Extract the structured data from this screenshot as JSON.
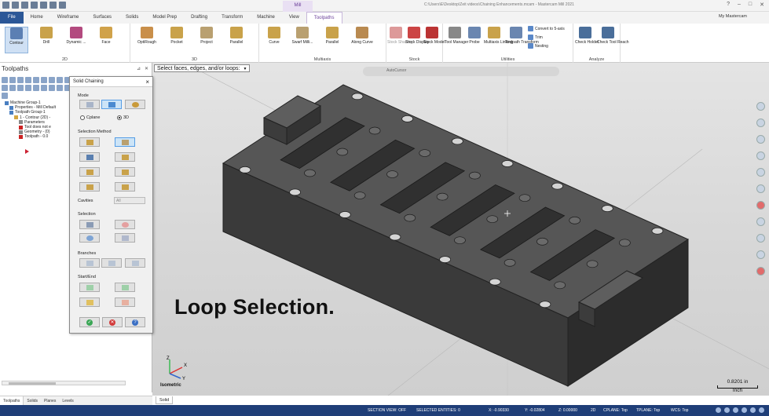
{
  "window": {
    "title": "C:\\Users\\E\\Desktop\\Zeit videos\\Chaining Enhancements.mcam - Mastercam Mill 2021",
    "context_tab": "Mill"
  },
  "tabs": [
    "File",
    "Home",
    "Wireframe",
    "Surfaces",
    "Solids",
    "Model Prep",
    "Drafting",
    "Transform",
    "Machine",
    "View",
    "Toolpaths"
  ],
  "active_tab": "Toolpaths",
  "my_mastercam": "My Mastercam",
  "ribbon": {
    "group_2d": {
      "label": "2D",
      "buttons": [
        "Contour",
        "Drill",
        "Dynamic ...",
        "Face"
      ]
    },
    "group_3d": {
      "label": "3D",
      "buttons": [
        "OptiRough",
        "Pocket",
        "Project",
        "Parallel"
      ]
    },
    "group_multiaxis": {
      "label": "Multiaxis",
      "buttons": [
        "Curve",
        "Swarf Milli...",
        "Parallel",
        "Along Curve"
      ]
    },
    "group_stock": {
      "label": "Stock",
      "buttons": [
        "Stock Shading",
        "Stock Display",
        "Stock Model"
      ]
    },
    "group_utilities": {
      "label": "Utilities",
      "buttons": [
        "Tool Manager",
        "Probe",
        "Multiaxis Linking",
        "Toolpath Transform"
      ],
      "small": [
        "Convert to 5-axis",
        "Trim",
        "Nesting"
      ]
    },
    "group_analyze": {
      "label": "Analyze",
      "buttons": [
        "Check Holder",
        "Check Tool Reach"
      ]
    }
  },
  "left_panel": {
    "title": "Toolpaths",
    "tree": [
      {
        "label": "Machine Group-1",
        "indent": 0,
        "color": "#4a7fc1"
      },
      {
        "label": "Properties - Mill Default",
        "indent": 1,
        "color": "#4a7fc1"
      },
      {
        "label": "Toolpath Group-1",
        "indent": 1,
        "color": "#4a7fc1"
      },
      {
        "label": "1 - Contour (2D) -",
        "indent": 2,
        "color": "#d4a640"
      },
      {
        "label": "Parameters",
        "indent": 3,
        "color": "#888888"
      },
      {
        "label": "Tool does not e",
        "indent": 3,
        "color": "#cc2222"
      },
      {
        "label": "Geometry - (0)",
        "indent": 3,
        "color": "#888888"
      },
      {
        "label": "Toolpath - 0.0",
        "indent": 3,
        "color": "#cc2222"
      }
    ]
  },
  "bottom_tabs": [
    "Toolpaths",
    "Solids",
    "Planes",
    "Levels"
  ],
  "viewport": {
    "prompt": "Select faces, edges, and/or loops:",
    "autocursor": "AutoCursor",
    "caption": "Loop Selection.",
    "view_name": "Isometric",
    "scale_value": "0.8201 in",
    "scale_unit": "Inch",
    "tab": "Solid",
    "axis_labels": {
      "x": "X",
      "y": "Y",
      "z": "Z"
    }
  },
  "dialog": {
    "title": "Solid Chaining",
    "mode_label": "Mode",
    "mode_options": [
      "Cplane",
      "3D"
    ],
    "mode_selected": "3D",
    "selection_method_label": "Selection Method",
    "cavities_label": "Cavities",
    "cavities_value": "All",
    "selection_label": "Selection",
    "branches_label": "Branches",
    "start_end_label": "Start/End"
  },
  "status": {
    "section_view": "SECTION VIEW: OFF",
    "selected_entities": "SELECTED ENTITIES: 0",
    "x": "X: -0.90330",
    "y": "Y: -0.02804",
    "z": "Z: 0.00000",
    "mode": "2D",
    "cplane": "CPLANE: Top",
    "tplane": "TPLANE: Top",
    "wcs": "WCS: Top"
  },
  "colors": {
    "accent": "#2b5797",
    "context": "#6a3f99",
    "status_bg": "#1f3e78"
  }
}
